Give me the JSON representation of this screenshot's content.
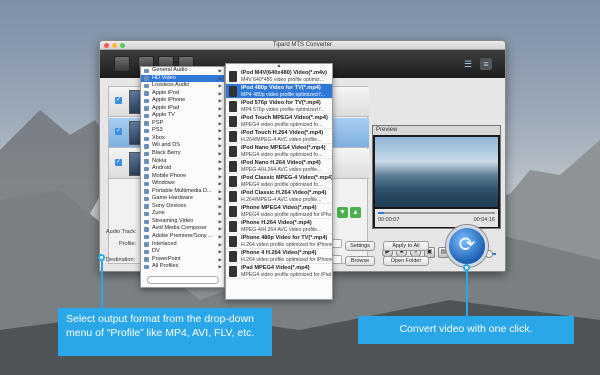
{
  "window": {
    "title": "Tipard MTS Converter"
  },
  "sidebar_menu": {
    "items": [
      {
        "label": "General Audio",
        "arrow": true
      },
      {
        "label": "HD Video",
        "arrow": true,
        "selected": true
      },
      {
        "label": "Lossless Audio",
        "arrow": true
      },
      {
        "label": "Apple iPod",
        "arrow": true
      },
      {
        "label": "Apple iPhone",
        "arrow": true
      },
      {
        "label": "Apple iPad",
        "arrow": true
      },
      {
        "label": "Apple TV",
        "arrow": true
      },
      {
        "label": "PSP",
        "arrow": true
      },
      {
        "label": "PS3",
        "arrow": true
      },
      {
        "label": "Xbox",
        "arrow": true
      },
      {
        "label": "Wii and DS",
        "arrow": true
      },
      {
        "label": "Black Berry",
        "arrow": true
      },
      {
        "label": "Nokia",
        "arrow": true
      },
      {
        "label": "Android",
        "arrow": true
      },
      {
        "label": "Mobile Phone",
        "arrow": true
      },
      {
        "label": "Windows",
        "arrow": true
      },
      {
        "label": "Portable Multimedia D...",
        "arrow": true
      },
      {
        "label": "Game Hardware",
        "arrow": true
      },
      {
        "label": "Sony Devices",
        "arrow": true
      },
      {
        "label": "Zune",
        "arrow": true
      },
      {
        "label": "Streaming Video",
        "arrow": true
      },
      {
        "label": "Avid Media Composer",
        "arrow": true
      },
      {
        "label": "Adobe Premiere/Sony ...",
        "arrow": true
      },
      {
        "label": "Interlaced",
        "arrow": true
      },
      {
        "label": "DV",
        "arrow": true
      },
      {
        "label": "PowerPoint",
        "arrow": true
      },
      {
        "label": "All Profiles",
        "arrow": true
      }
    ]
  },
  "profile_menu": {
    "items": [
      {
        "title": "iPod M4V(640x480) Video(*.m4v)",
        "desc": "M4V 640*480 video profile optimiz..."
      },
      {
        "title": "iPod 480p Video for TV(*.mp4)",
        "desc": "MP4 480p video profile optimized f...",
        "selected": true
      },
      {
        "title": "iPod 576p Video for TV(*.mp4)",
        "desc": "MP4 576p video profile optimized f..."
      },
      {
        "title": "iPod Touch MPEG4 Video(*.mp4)",
        "desc": "MPEG4 video profile optimized fo..."
      },
      {
        "title": "iPod Touch H.264 Video(*.mp4)",
        "desc": "H.264/MPEG-4 AVC video profile..."
      },
      {
        "title": "iPod Nano MPEG4 Video(*.mp4)",
        "desc": "MPEG4 video profile optimized fo..."
      },
      {
        "title": "iPod Nano H.264 Video(*.mp4)",
        "desc": "MPEG-4/H.264 AVC video profile..."
      },
      {
        "title": "iPod Classic MPEG-4 Video(*.mp4)",
        "desc": "MPEG4 video profile optimized fo..."
      },
      {
        "title": "iPod Classic H.264 Video(*.mp4)",
        "desc": "H.264/MPEG-4 AVC video profile..."
      },
      {
        "title": "iPhone MPEG4 Video(*.mp4)",
        "desc": "MPEG4 video profile optimized for iPho..."
      },
      {
        "title": "iPhone H.264 Video(*.mp4)",
        "desc": "MPEG-4/H.264 AVC video profile..."
      },
      {
        "title": "iPhone 480p Video for TV(*.mp4)",
        "desc": "H.264 video profile optimized for iPhone"
      },
      {
        "title": "iPhone 4 H.264 Video(*.mp4)",
        "desc": "H.264 video profile optimized for iPhone"
      },
      {
        "title": "iPad MPEG4 Video(*.mp4)",
        "desc": "MPEG4 video profile optimized for iPad"
      }
    ]
  },
  "preview": {
    "label": "Preview",
    "time_current": "00:00:07",
    "time_total": "00:04:16"
  },
  "bottom": {
    "audio_track_label": "Audio Track:",
    "profile_label": "Profile:",
    "destination_label": "Destination:",
    "settings_button": "Settings",
    "apply_all_button": "Apply to All",
    "browse_button": "Browse",
    "open_folder_button": "Open Folder"
  },
  "callouts": {
    "left": "Select output format from the drop-down menu of “Profile” like MP4, AVI, FLV, etc.",
    "right": "Convert video with one click."
  },
  "colors": {
    "accent": "#29a7e8",
    "selection": "#2f78d8"
  }
}
